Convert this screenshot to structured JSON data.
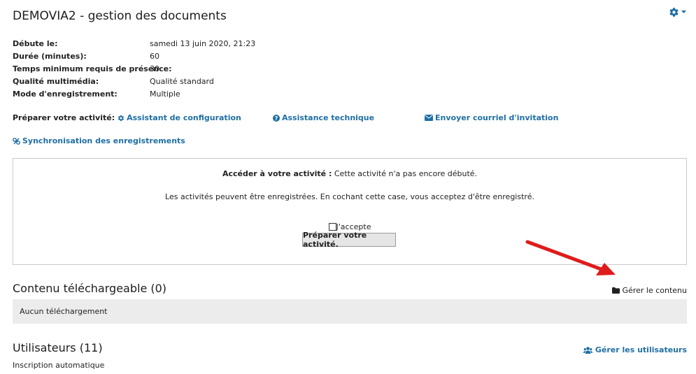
{
  "header": {
    "title": "DEMOVIA2 - gestion des documents",
    "accent_color": "#1f6fa5"
  },
  "info": [
    {
      "label": "Débute le:",
      "value": "samedi 13 juin 2020, 21:23"
    },
    {
      "label": "Durée (minutes):",
      "value": "60"
    },
    {
      "label": "Temps minimum requis de présence:",
      "value": "30"
    },
    {
      "label": "Qualité multimédia:",
      "value": "Qualité standard"
    },
    {
      "label": "Mode d'enregistrement:",
      "value": "Multiple"
    }
  ],
  "prepare": {
    "label": "Préparer votre activité:",
    "links": {
      "assistant": "Assistant de configuration",
      "support": "Assistance technique",
      "email": "Envoyer courriel d'invitation",
      "sync": "Synchronisation des enregistrements"
    }
  },
  "access_box": {
    "access_label": "Accéder à votre activité :",
    "access_status": "Cette activité n'a pas encore débuté.",
    "record_notice": "Les activités peuvent être enregistrées. En cochant cette case, vous acceptez d'être enregistré.",
    "checkbox_label": "J'accepte",
    "checkbox_checked": false,
    "button_label": "Préparer votre activité."
  },
  "downloads": {
    "title": "Contenu téléchargeable (0)",
    "manage_label": "Gérer le contenu",
    "empty_text": "Aucun téléchargement"
  },
  "users": {
    "title": "Utilisateurs (11)",
    "manage_label": "Gérer les utilisateurs",
    "subtitle": "Inscription automatique"
  },
  "annotation": {
    "arrow_color": "#e01b1b",
    "points_to": "Gérer le contenu"
  }
}
